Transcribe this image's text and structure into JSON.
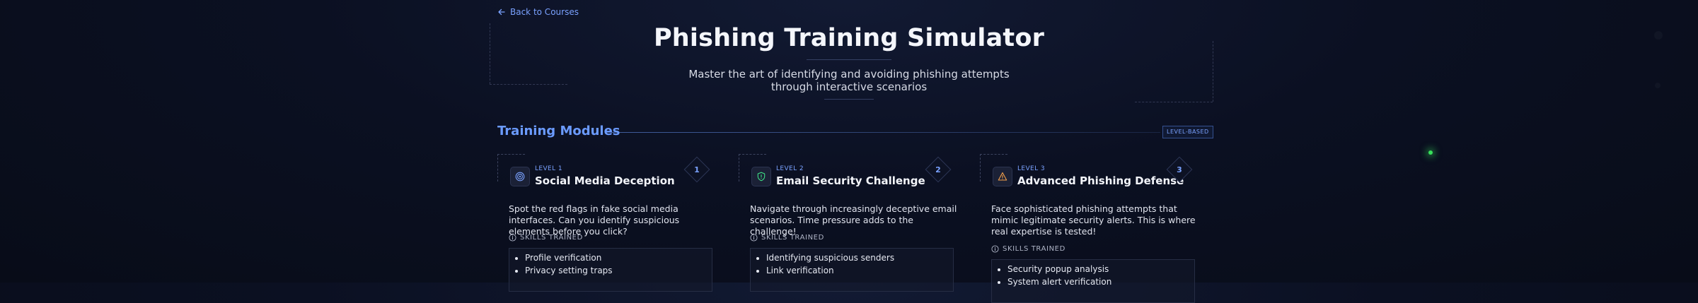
{
  "nav": {
    "back_label": "Back to Courses"
  },
  "hero": {
    "title": "Phishing Training Simulator",
    "subtitle": "Master the art of identifying and avoiding phishing attempts through interactive scenarios"
  },
  "modules": {
    "section_title": "Training Modules",
    "badge": "LEVEL-BASED",
    "skills_heading": "SKILLS TRAINED",
    "cards": [
      {
        "level": "LEVEL 1",
        "title": "Social Media Deception",
        "number": "1",
        "icon": "target-icon",
        "description": "Spot the red flags in fake social media interfaces. Can you identify suspicious elements before you click?",
        "skills": [
          "Profile verification",
          "Privacy setting traps"
        ]
      },
      {
        "level": "LEVEL 2",
        "title": "Email Security Challenge",
        "number": "2",
        "icon": "shield-icon",
        "description": "Navigate through increasingly deceptive email scenarios. Time pressure adds to the challenge!",
        "skills": [
          "Identifying suspicious senders",
          "Link verification"
        ]
      },
      {
        "level": "LEVEL 3",
        "title": "Advanced Phishing Defense",
        "number": "3",
        "icon": "warning-icon",
        "description": "Face sophisticated phishing attempts that mimic legitimate security alerts. This is where real expertise is tested!",
        "skills": [
          "Security popup analysis",
          "System alert verification"
        ]
      }
    ]
  },
  "colors": {
    "accent": "#6b9bff",
    "shield_green": "#3ddc84",
    "warning_orange": "#f5a14a",
    "status_dot": "#37e05a"
  }
}
